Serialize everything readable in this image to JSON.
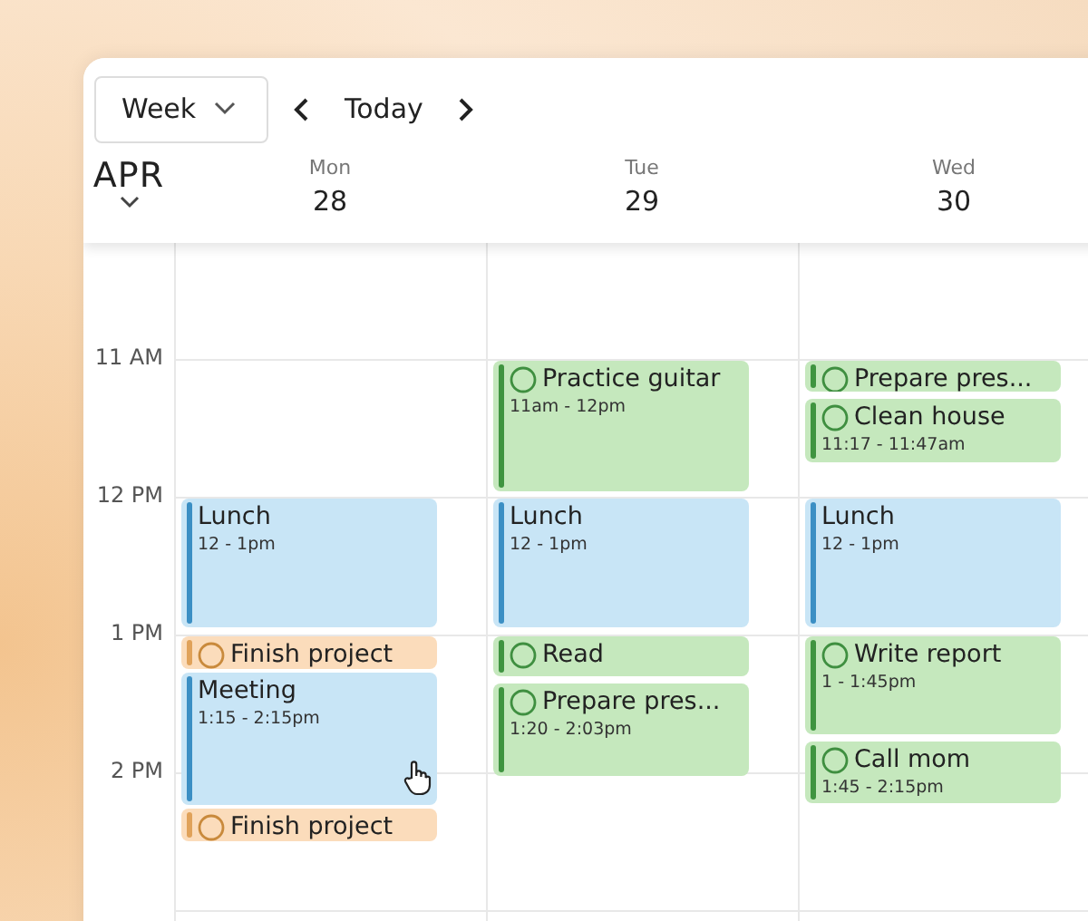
{
  "toolbar": {
    "view": "Week",
    "today": "Today"
  },
  "month": "APR",
  "hours": [
    "11 AM",
    "12 PM",
    "1 PM",
    "2 PM"
  ],
  "days": [
    {
      "name": "Mon",
      "date": "28",
      "events": [
        {
          "kind": "event",
          "color": "#3b8fc4",
          "title": "Lunch",
          "time": "12 - 1pm"
        },
        {
          "kind": "task",
          "color": "#e0a25a",
          "title": "Finish project"
        },
        {
          "kind": "event",
          "color": "#3b8fc4",
          "title": "Meeting",
          "time": "1:15 - 2:15pm"
        },
        {
          "kind": "task",
          "color": "#e0a25a",
          "title": "Finish project"
        }
      ]
    },
    {
      "name": "Tue",
      "date": "29",
      "events": [
        {
          "kind": "task",
          "color": "#3f9440",
          "title": "Practice guitar",
          "time": "11am - 12pm"
        },
        {
          "kind": "event",
          "color": "#3b8fc4",
          "title": "Lunch",
          "time": "12 - 1pm"
        },
        {
          "kind": "task",
          "color": "#3f9440",
          "title": "Read"
        },
        {
          "kind": "task",
          "color": "#3f9440",
          "title": "Prepare pres...",
          "time": "1:20 - 2:03pm"
        }
      ]
    },
    {
      "name": "Wed",
      "date": "30",
      "events": [
        {
          "kind": "task",
          "color": "#3f9440",
          "title": "Prepare pres..."
        },
        {
          "kind": "task",
          "color": "#3f9440",
          "title": "Clean house",
          "time": "11:17 - 11:47am"
        },
        {
          "kind": "event",
          "color": "#3b8fc4",
          "title": "Lunch",
          "time": "12 - 1pm"
        },
        {
          "kind": "task",
          "color": "#3f9440",
          "title": "Write report",
          "time": "1 - 1:45pm"
        },
        {
          "kind": "task",
          "color": "#3f9440",
          "title": "Call mom",
          "time": "1:45 - 2:15pm"
        }
      ]
    }
  ]
}
